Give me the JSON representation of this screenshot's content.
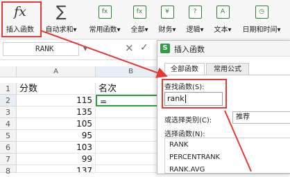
{
  "ribbon": {
    "insert_function": {
      "label": "插入函数",
      "glyph": "fx"
    },
    "autosum": {
      "label": "自动求和",
      "glyph": "∑"
    },
    "common_functions": {
      "label": "常用函数",
      "glyph": "fx"
    },
    "all": {
      "label": "全部",
      "glyph": "fx"
    },
    "finance": {
      "label": "财务",
      "glyph": "¥"
    },
    "logic": {
      "label": "逻辑",
      "glyph": "?"
    },
    "text": {
      "label": "文本",
      "glyph": "A"
    },
    "datetime": {
      "label": "日期和时间",
      "glyph": "◷"
    },
    "dropdown_glyph": "▾"
  },
  "formula_bar": {
    "name_box": "RANK",
    "cancel_glyph": "×",
    "confirm_glyph": "✓",
    "fx_glyph": "fx"
  },
  "sheet": {
    "columns": [
      "A",
      "B"
    ],
    "rows": [
      {
        "num": "1",
        "a": "分数",
        "b": "名次"
      },
      {
        "num": "2",
        "a": "115",
        "b": "="
      },
      {
        "num": "3",
        "a": "135",
        "b": ""
      },
      {
        "num": "4",
        "a": "105",
        "b": ""
      },
      {
        "num": "5",
        "a": "95",
        "b": ""
      },
      {
        "num": "6",
        "a": "103",
        "b": ""
      },
      {
        "num": "7",
        "a": "99",
        "b": ""
      },
      {
        "num": "8",
        "a": "137",
        "b": ""
      }
    ]
  },
  "dialog": {
    "logo": "S",
    "title": "插入函数",
    "tabs": [
      "全部函数",
      "常用公式"
    ],
    "search_label": "查找函数(S):",
    "search_value": "rank",
    "category_label": "或选择类别(C):",
    "category_value": "推荐",
    "select_label": "选择函数(N):",
    "functions": [
      "RANK",
      "PERCENTRANK",
      "RANK.AVG"
    ]
  },
  "colors": {
    "highlight": "#e53935",
    "accent": "#2e9e44"
  }
}
